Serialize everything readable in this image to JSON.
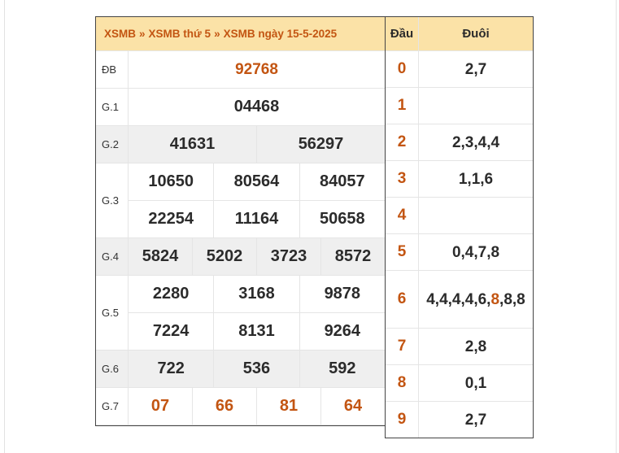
{
  "breadcrumb": {
    "items": [
      "XSMB",
      "XSMB thứ 5",
      "XSMB ngày 15-5-2025"
    ],
    "separator": "»"
  },
  "prizes": [
    {
      "label": "ĐB",
      "rows": [
        [
          "92768"
        ]
      ],
      "style": "red",
      "gray": false
    },
    {
      "label": "G.1",
      "rows": [
        [
          "04468"
        ]
      ],
      "style": "normal",
      "gray": false
    },
    {
      "label": "G.2",
      "rows": [
        [
          "41631",
          "56297"
        ]
      ],
      "style": "normal",
      "gray": true
    },
    {
      "label": "G.3",
      "rows": [
        [
          "10650",
          "80564",
          "84057"
        ],
        [
          "22254",
          "11164",
          "50658"
        ]
      ],
      "style": "normal",
      "gray": false
    },
    {
      "label": "G.4",
      "rows": [
        [
          "5824",
          "5202",
          "3723",
          "8572"
        ]
      ],
      "style": "normal",
      "gray": true
    },
    {
      "label": "G.5",
      "rows": [
        [
          "2280",
          "3168",
          "9878"
        ],
        [
          "7224",
          "8131",
          "9264"
        ]
      ],
      "style": "normal",
      "gray": false
    },
    {
      "label": "G.6",
      "rows": [
        [
          "722",
          "536",
          "592"
        ]
      ],
      "style": "normal",
      "gray": true
    },
    {
      "label": "G.7",
      "rows": [
        [
          "07",
          "66",
          "81",
          "64"
        ]
      ],
      "style": "red",
      "gray": false
    }
  ],
  "headtail": {
    "head_label": "Đầu",
    "tail_label": "Đuôi",
    "rows": [
      {
        "dau": "0",
        "duoi": "2,7"
      },
      {
        "dau": "1",
        "duoi": ""
      },
      {
        "dau": "2",
        "duoi": "2,3,4,4"
      },
      {
        "dau": "3",
        "duoi": "1,1,6"
      },
      {
        "dau": "4",
        "duoi": ""
      },
      {
        "dau": "5",
        "duoi": "0,4,7,8"
      },
      {
        "dau": "6",
        "duoi_parts": [
          "4,4,4,4,6,",
          "8",
          ",8,8"
        ],
        "highlight_index": 1
      },
      {
        "dau": "7",
        "duoi": "2,8"
      },
      {
        "dau": "8",
        "duoi": "0,1"
      },
      {
        "dau": "9",
        "duoi": "2,7"
      }
    ]
  },
  "colors": {
    "accent": "#c35512",
    "header_bg": "#fbe2a7",
    "row_gray": "#efefef",
    "text": "#2b2b2b"
  }
}
